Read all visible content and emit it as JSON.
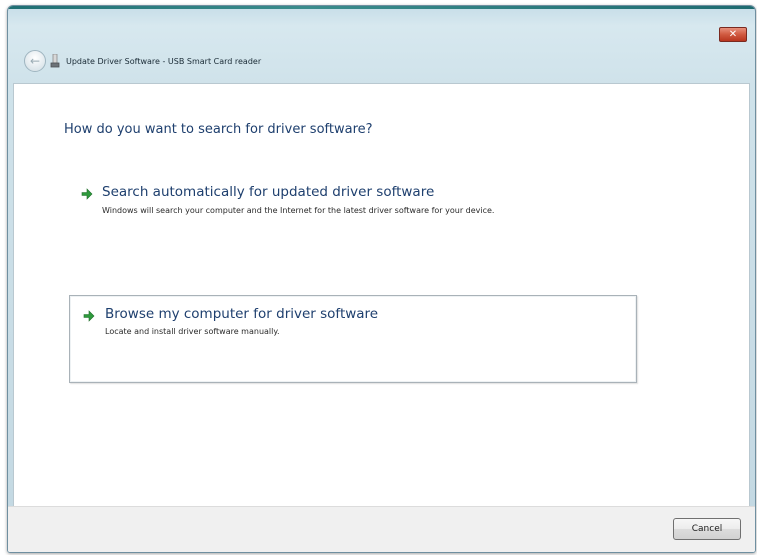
{
  "window": {
    "title": "Update Driver Software - USB Smart Card reader",
    "close_icon": "close-icon",
    "close_glyph": "✕",
    "back_icon": "back-arrow-icon",
    "back_glyph": "←",
    "device_icon": "device-icon"
  },
  "main": {
    "question": "How do you want to search for driver software?",
    "options": [
      {
        "icon": "green-arrow-icon",
        "title": "Search automatically for updated driver software",
        "description": "Windows will search your computer and the Internet for the latest driver software for your device."
      },
      {
        "icon": "green-arrow-icon",
        "title": "Browse my computer for driver software",
        "description": "Locate and install driver software manually."
      }
    ]
  },
  "footer": {
    "cancel_label": "Cancel"
  },
  "colors": {
    "accent_arrow": "#2e9a3c",
    "link_text": "#1e3f6e",
    "close_button": "#c8452b"
  }
}
